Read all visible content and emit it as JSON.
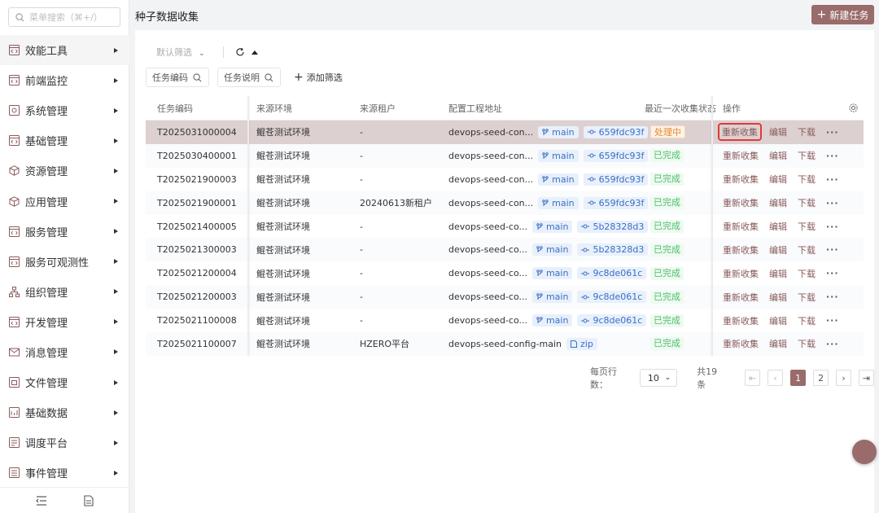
{
  "sidebar": {
    "search_placeholder": "菜单搜索（⌘+/）",
    "items": [
      {
        "label": "效能工具",
        "icon": "code-window-icon",
        "active": true
      },
      {
        "label": "前端监控",
        "icon": "code-window-icon"
      },
      {
        "label": "系统管理",
        "icon": "settings-icon"
      },
      {
        "label": "基础管理",
        "icon": "code-window-icon"
      },
      {
        "label": "资源管理",
        "icon": "cube-icon"
      },
      {
        "label": "应用管理",
        "icon": "cube-icon"
      },
      {
        "label": "服务管理",
        "icon": "code-window-icon"
      },
      {
        "label": "服务可观测性",
        "icon": "code-window-icon"
      },
      {
        "label": "组织管理",
        "icon": "org-tree-icon"
      },
      {
        "label": "开发管理",
        "icon": "code-window-icon"
      },
      {
        "label": "消息管理",
        "icon": "mail-icon"
      },
      {
        "label": "文件管理",
        "icon": "folder-icon"
      },
      {
        "label": "基础数据",
        "icon": "database-icon"
      },
      {
        "label": "调度平台",
        "icon": "schedule-icon"
      },
      {
        "label": "事件管理",
        "icon": "list-icon"
      }
    ]
  },
  "header": {
    "title": "种子数据收集",
    "new_button": "新建任务"
  },
  "filters": {
    "default_filter": "默认筛选",
    "chip1": "任务编码",
    "chip2": "任务说明",
    "add_filter": "添加筛选"
  },
  "table": {
    "columns": [
      "任务编码",
      "来源环境",
      "来源租户",
      "配置工程地址",
      "最近一次收集状态",
      "操作"
    ],
    "rows": [
      {
        "code": "T2025031000004",
        "env": "鲲苍测试环境",
        "tenant": "-",
        "repo": "devops-seed-con...",
        "branch": "main",
        "commit": "659fdc93f",
        "status": "处理中",
        "status_type": "proc",
        "selected": true
      },
      {
        "code": "T2025030400001",
        "env": "鲲苍测试环境",
        "tenant": "-",
        "repo": "devops-seed-con...",
        "branch": "main",
        "commit": "659fdc93f",
        "status": "已完成",
        "status_type": "done"
      },
      {
        "code": "T2025021900003",
        "env": "鲲苍测试环境",
        "tenant": "-",
        "repo": "devops-seed-con...",
        "branch": "main",
        "commit": "659fdc93f",
        "status": "已完成",
        "status_type": "done"
      },
      {
        "code": "T2025021900001",
        "env": "鲲苍测试环境",
        "tenant": "20240613新租户",
        "repo": "devops-seed-con...",
        "branch": "main",
        "commit": "659fdc93f",
        "status": "已完成",
        "status_type": "done"
      },
      {
        "code": "T2025021400005",
        "env": "鲲苍测试环境",
        "tenant": "-",
        "repo": "devops-seed-co...",
        "branch": "main",
        "commit": "5b28328d3",
        "status": "已完成",
        "status_type": "done"
      },
      {
        "code": "T2025021300003",
        "env": "鲲苍测试环境",
        "tenant": "-",
        "repo": "devops-seed-co...",
        "branch": "main",
        "commit": "5b28328d3",
        "status": "已完成",
        "status_type": "done"
      },
      {
        "code": "T2025021200004",
        "env": "鲲苍测试环境",
        "tenant": "-",
        "repo": "devops-seed-co...",
        "branch": "main",
        "commit": "9c8de061c",
        "status": "已完成",
        "status_type": "done"
      },
      {
        "code": "T2025021200003",
        "env": "鲲苍测试环境",
        "tenant": "-",
        "repo": "devops-seed-co...",
        "branch": "main",
        "commit": "9c8de061c",
        "status": "已完成",
        "status_type": "done"
      },
      {
        "code": "T2025021100008",
        "env": "鲲苍测试环境",
        "tenant": "-",
        "repo": "devops-seed-co...",
        "branch": "main",
        "commit": "9c8de061c",
        "status": "已完成",
        "status_type": "done"
      },
      {
        "code": "T2025021100007",
        "env": "鲲苍测试环境",
        "tenant": "HZERO平台",
        "repo": "devops-seed-config-main",
        "branch": "",
        "commit": "",
        "zip": "zip",
        "status": "已完成",
        "status_type": "done"
      }
    ],
    "actions": {
      "recollect": "重新收集",
      "edit": "编辑",
      "download": "下载",
      "more": "···"
    }
  },
  "pagination": {
    "rows_per_page_label": "每页行数：",
    "page_size": "10",
    "total": "共19条",
    "pages": [
      "1",
      "2"
    ],
    "current_page": "1"
  },
  "colors": {
    "brand": "#9a6b6b",
    "done": "#4bbf6a",
    "processing": "#e8872b",
    "link": "#3b6fc6"
  }
}
